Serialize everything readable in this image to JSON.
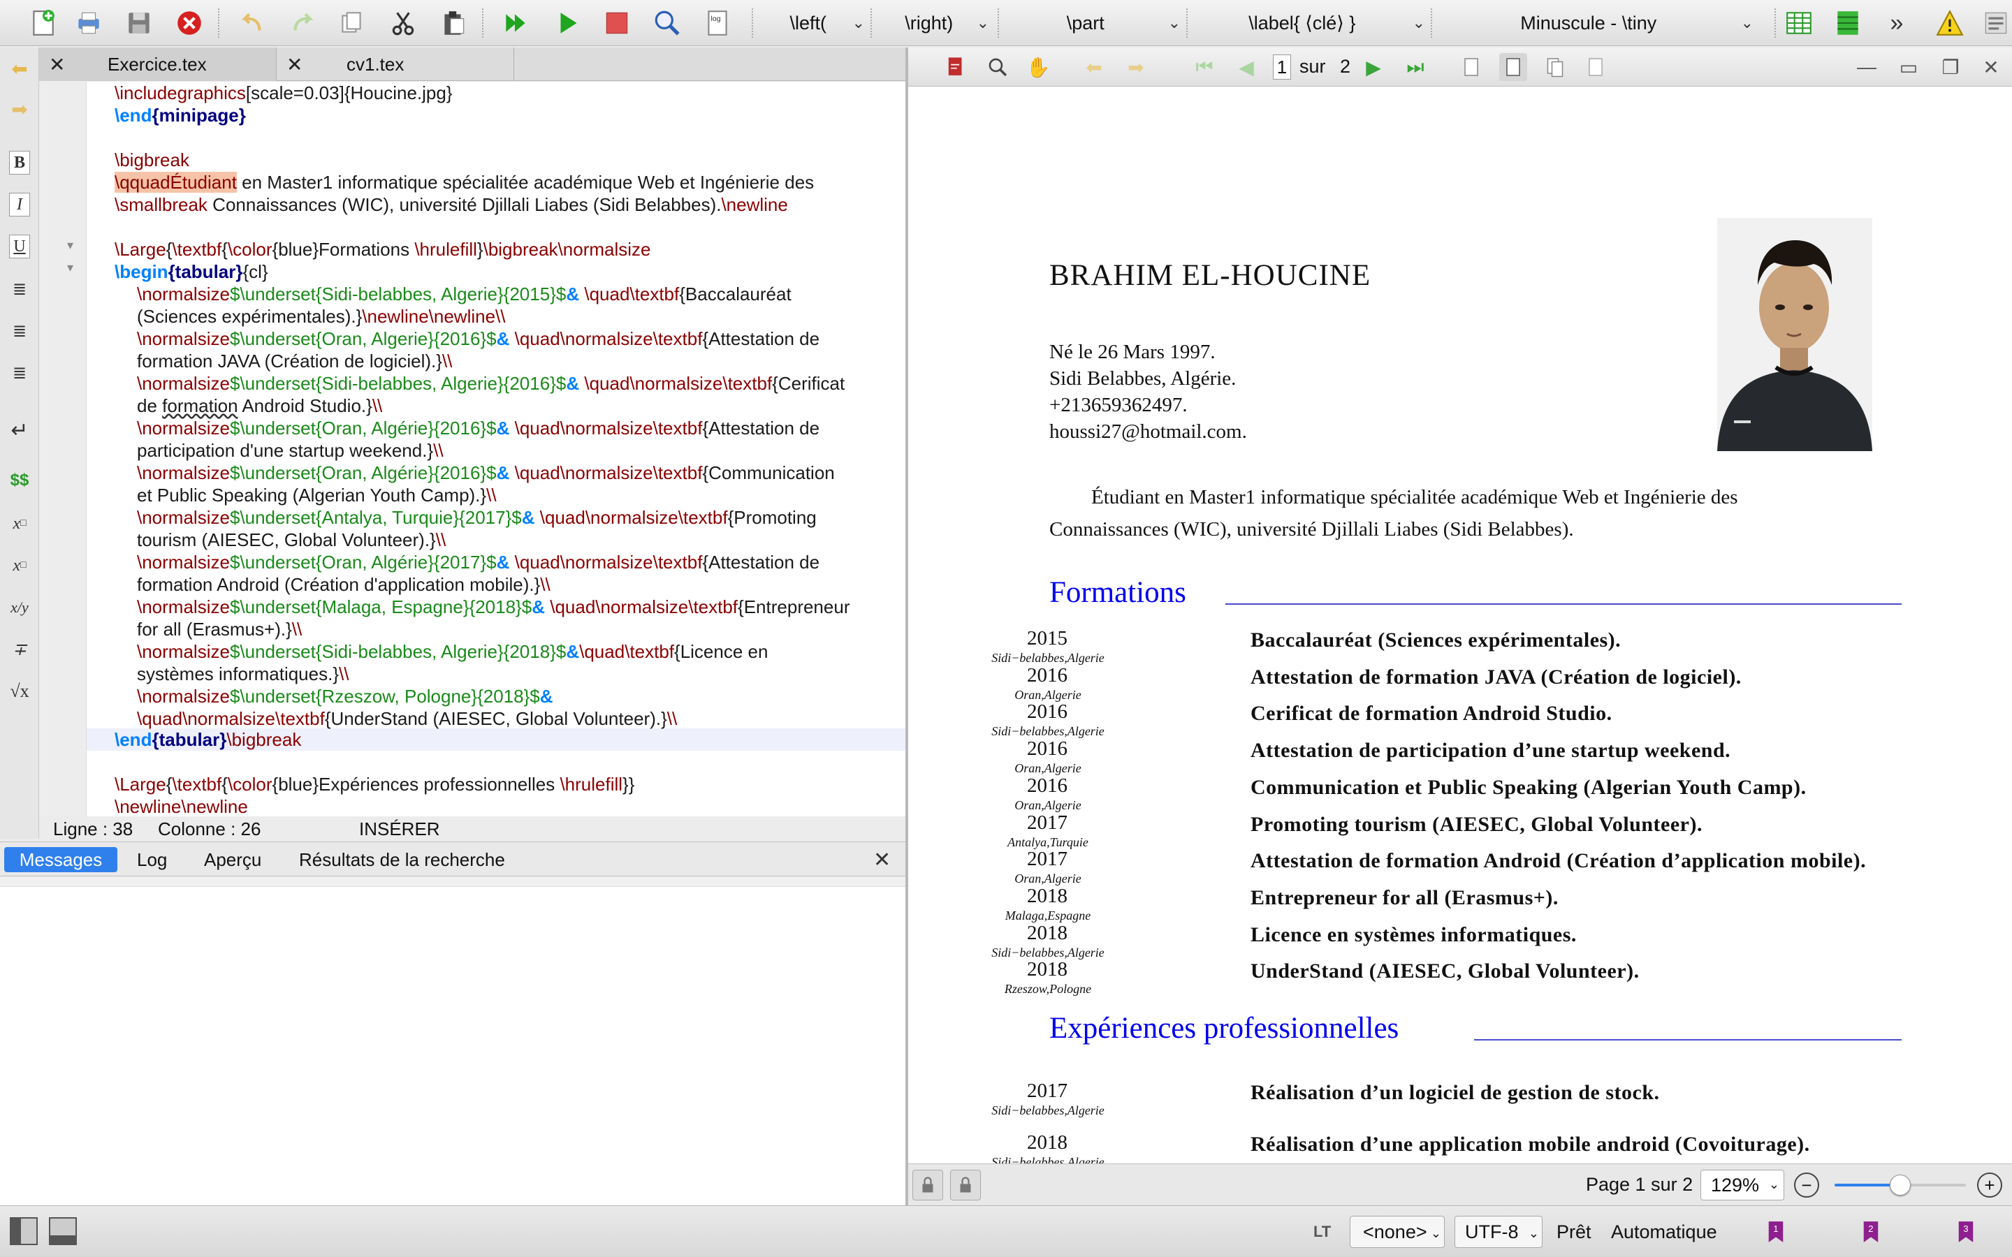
{
  "toolbar": {
    "dropdowns": [
      {
        "label": "\\left("
      },
      {
        "label": "\\right)"
      },
      {
        "label": "\\part"
      },
      {
        "label": "\\label{ ⟨clé⟩ }"
      },
      {
        "label": "Minuscule - \\tiny"
      }
    ]
  },
  "editor": {
    "tabs": [
      {
        "label": "Exercice.tex",
        "active": true
      },
      {
        "label": "cv1.tex",
        "active": false
      }
    ],
    "status": {
      "line": "Ligne : 38",
      "column": "Colonne : 26",
      "mode": "INSÉRER"
    }
  },
  "messages": {
    "tabs": [
      "Messages",
      "Log",
      "Aperçu",
      "Résultats de la recherche"
    ],
    "active": "Messages"
  },
  "pdf": {
    "page_current": "1",
    "page_of": "sur",
    "page_total": "2",
    "footer_page": "Page 1 sur 2",
    "zoom": "129%",
    "zoom_level": 0.5,
    "name": "BRAHIM EL-HOUCINE",
    "contact": [
      "Né le 26 Mars 1997.",
      "Sidi Belabbes, Algérie.",
      "+213659362497.",
      "houssi27@hotmail.com."
    ],
    "intro_1": "Étudiant en Master1 informatique spécialitée académique Web et Ingénierie des",
    "intro_2": "Connaissances (WIC), université Djillali Liabes (Sidi Belabbes).",
    "formations_title": "Formations",
    "formations": [
      {
        "year": "2015",
        "loc": "Sidi−belabbes,Algerie",
        "text": "Baccalauréat (Sciences expérimentales)."
      },
      {
        "year": "2016",
        "loc": "Oran,Algerie",
        "text": "Attestation de formation JAVA (Création de logiciel)."
      },
      {
        "year": "2016",
        "loc": "Sidi−belabbes,Algerie",
        "text": "Cerificat de formation Android Studio."
      },
      {
        "year": "2016",
        "loc": "Oran,Algerie",
        "text": "Attestation de participation d’une startup weekend."
      },
      {
        "year": "2016",
        "loc": "Oran,Algerie",
        "text": "Communication et Public Speaking (Algerian Youth Camp)."
      },
      {
        "year": "2017",
        "loc": "Antalya,Turquie",
        "text": "Promoting tourism (AIESEC, Global Volunteer)."
      },
      {
        "year": "2017",
        "loc": "Oran,Algerie",
        "text": "Attestation de formation Android (Création d’application mobile)."
      },
      {
        "year": "2018",
        "loc": "Malaga,Espagne",
        "text": "Entrepreneur for all (Erasmus+)."
      },
      {
        "year": "2018",
        "loc": "Sidi−belabbes,Algerie",
        "text": "Licence en systèmes informatiques."
      },
      {
        "year": "2018",
        "loc": "Rzeszow,Pologne",
        "text": "UnderStand (AIESEC, Global Volunteer)."
      }
    ],
    "experiences_title": "Expériences professionnelles",
    "experiences": [
      {
        "year": "2017",
        "loc": "Sidi−belabbes,Algerie",
        "text": "Réalisation d’un logiciel de gestion de stock."
      },
      {
        "year": "2018",
        "loc": "Sidi−belabbes,Algerie",
        "text": "Réalisation d’une application mobile android (Covoiturage)."
      }
    ]
  },
  "statusbar": {
    "lt": "LT",
    "language": "<none>",
    "encoding": "UTF-8",
    "ready": "Prêt",
    "mode": "Automatique",
    "bookmarks": [
      "1",
      "2",
      "3"
    ]
  }
}
